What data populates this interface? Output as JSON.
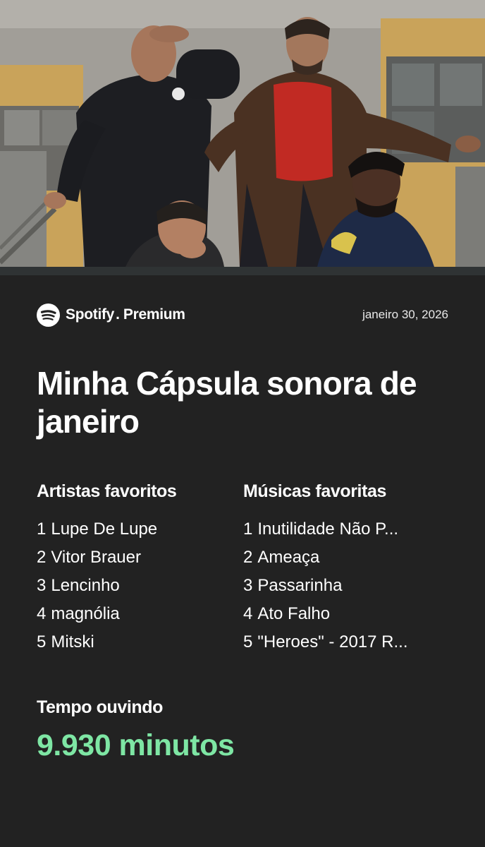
{
  "brand": {
    "name": "Spotify",
    "dot": ".",
    "tier": "Premium",
    "logo_icon": "spotify-logo-icon"
  },
  "date": "janeiro 30, 2026",
  "title": "Minha Cápsula sonora de janeiro",
  "artists": {
    "heading": "Artistas favoritos",
    "items": [
      {
        "rank": "1",
        "name": "Lupe De Lupe"
      },
      {
        "rank": "2",
        "name": "Vitor Brauer"
      },
      {
        "rank": "3",
        "name": "Lencinho"
      },
      {
        "rank": "4",
        "name": "magnólia"
      },
      {
        "rank": "5",
        "name": "Mitski"
      }
    ]
  },
  "songs": {
    "heading": "Músicas favoritas",
    "items": [
      {
        "rank": "1",
        "name": "Inutilidade Não P..."
      },
      {
        "rank": "2",
        "name": "Ameaça"
      },
      {
        "rank": "3",
        "name": "Passarinha"
      },
      {
        "rank": "4",
        "name": "Ato Falho"
      },
      {
        "rank": "5",
        "name": "\"Heroes\" - 2017 R..."
      }
    ]
  },
  "listening": {
    "label": "Tempo ouvindo",
    "value": "9.930 minutos"
  },
  "colors": {
    "background": "#222222",
    "accent": "#7ee6a4",
    "text": "#ffffff"
  }
}
